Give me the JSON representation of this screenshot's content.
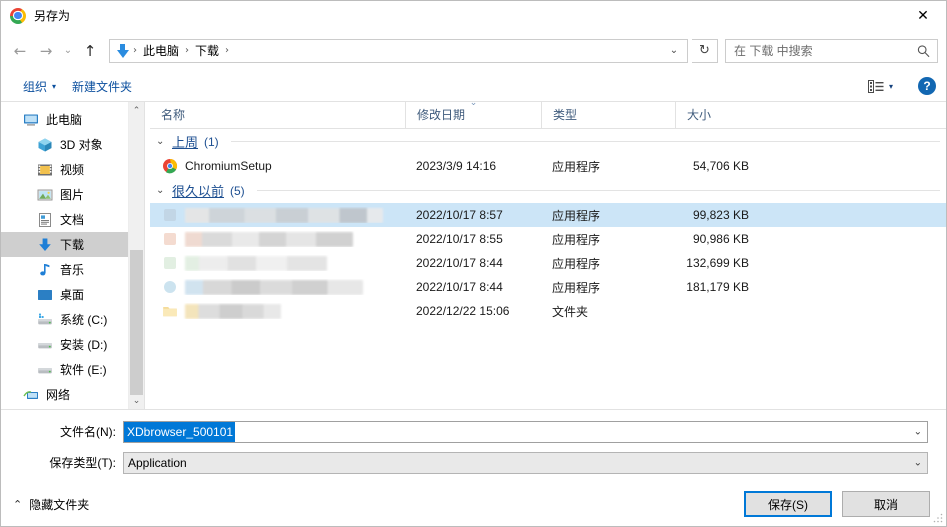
{
  "window": {
    "title": "另存为",
    "app_icon": "chrome-icon",
    "close_label": "✕"
  },
  "nav": {
    "back": "←",
    "forward": "→",
    "recent": "⌄",
    "up": "↑",
    "refresh": "↻",
    "dropdown": "⌄"
  },
  "breadcrumb": {
    "icon": "downloads-arrow-icon",
    "items": [
      "此电脑",
      "下载"
    ],
    "separator": "›"
  },
  "search": {
    "placeholder": "在 下载 中搜索",
    "icon": "search-icon"
  },
  "commandbar": {
    "organize_label": "组织",
    "organize_caret": "▾",
    "new_folder_label": "新建文件夹",
    "view_caret": "▾",
    "help_label": "?"
  },
  "sidebar": {
    "items": [
      {
        "label": "此电脑",
        "icon": "computer-icon",
        "indent": false,
        "selected": false
      },
      {
        "label": "3D 对象",
        "icon": "3d-objects-icon",
        "indent": true,
        "selected": false
      },
      {
        "label": "视频",
        "icon": "videos-icon",
        "indent": true,
        "selected": false
      },
      {
        "label": "图片",
        "icon": "pictures-icon",
        "indent": true,
        "selected": false
      },
      {
        "label": "文档",
        "icon": "documents-icon",
        "indent": true,
        "selected": false
      },
      {
        "label": "下载",
        "icon": "downloads-icon",
        "indent": true,
        "selected": true
      },
      {
        "label": "音乐",
        "icon": "music-icon",
        "indent": true,
        "selected": false
      },
      {
        "label": "桌面",
        "icon": "desktop-icon",
        "indent": true,
        "selected": false
      },
      {
        "label": "系统 (C:)",
        "icon": "drive-icon",
        "indent": true,
        "selected": false
      },
      {
        "label": "安装 (D:)",
        "icon": "drive-icon",
        "indent": true,
        "selected": false
      },
      {
        "label": "软件 (E:)",
        "icon": "drive-icon",
        "indent": true,
        "selected": false
      },
      {
        "label": "网络",
        "icon": "network-icon",
        "indent": false,
        "selected": false
      }
    ],
    "scroll_up": "⌃",
    "scroll_down": "⌄"
  },
  "filelist": {
    "columns": [
      {
        "label": "名称",
        "sorted": false
      },
      {
        "label": "修改日期",
        "sorted": true,
        "sort_mark": "⌄"
      },
      {
        "label": "类型",
        "sorted": false
      },
      {
        "label": "大小",
        "sorted": false
      }
    ],
    "groups": [
      {
        "title": "上周",
        "count": "(1)",
        "chevron": "⌄",
        "rows": [
          {
            "name": "ChromiumSetup",
            "redacted": false,
            "icon": "chrome-file-icon",
            "date": "2023/3/9 14:16",
            "type": "应用程序",
            "size": "54,706 KB",
            "selected": false
          }
        ]
      },
      {
        "title": "很久以前",
        "count": "(5)",
        "chevron": "⌄",
        "rows": [
          {
            "name": "",
            "redacted": true,
            "mosaic": "m1",
            "icon": "app-icon-blue",
            "date": "2022/10/17 8:57",
            "type": "应用程序",
            "size": "99,823 KB",
            "selected": true
          },
          {
            "name": "",
            "redacted": true,
            "mosaic": "m2",
            "icon": "app-icon-orange",
            "date": "2022/10/17 8:55",
            "type": "应用程序",
            "size": "90,986 KB",
            "selected": false
          },
          {
            "name": "",
            "redacted": true,
            "mosaic": "m3",
            "icon": "app-icon-green",
            "date": "2022/10/17 8:44",
            "type": "应用程序",
            "size": "132,699 KB",
            "selected": false
          },
          {
            "name": "",
            "redacted": true,
            "mosaic": "m4",
            "icon": "app-icon-cyan",
            "date": "2022/10/17 8:44",
            "type": "应用程序",
            "size": "181,179 KB",
            "selected": false
          },
          {
            "name": "",
            "redacted": true,
            "mosaic": "m5",
            "icon": "folder-icon",
            "date": "2022/12/22 15:06",
            "type": "文件夹",
            "size": "",
            "selected": false
          }
        ]
      }
    ]
  },
  "form": {
    "filename_label": "文件名(N):",
    "filename_value": "XDbrowser_500101",
    "savetype_label": "保存类型(T):",
    "savetype_value": "Application",
    "caret": "⌄"
  },
  "footer": {
    "hide_folders_label": "隐藏文件夹",
    "hide_folders_chevron": "⌃",
    "save_label": "保存(S)",
    "cancel_label": "取消"
  }
}
